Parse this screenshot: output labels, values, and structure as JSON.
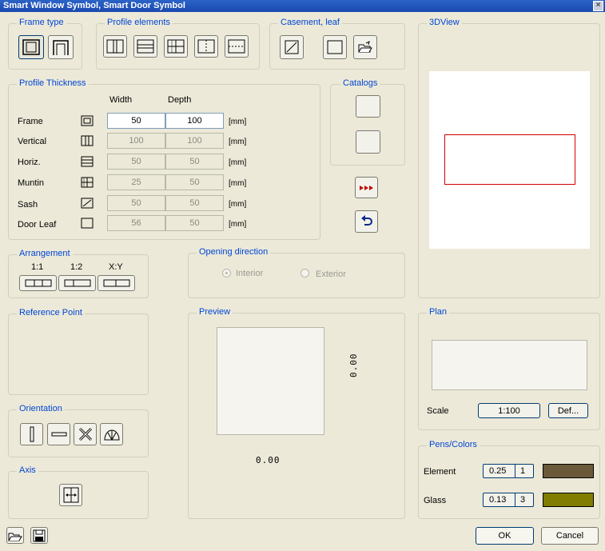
{
  "window": {
    "title": "Smart Window Symbol, Smart Door Symbol",
    "close": "×"
  },
  "groups": {
    "frame_type": "Frame type",
    "profile_elements": "Profile elements",
    "casement": "Casement, leaf",
    "view3d": "3DView",
    "profile_thickness": "Profile Thickness",
    "catalogs": "Catalogs",
    "arrangement": "Arrangement",
    "opening_direction": "Opening direction",
    "reference_point": "Reference Point",
    "preview": "Preview",
    "plan": "Plan",
    "orientation": "Orientation",
    "pens_colors": "Pens/Colors",
    "axis": "Axis"
  },
  "thickness": {
    "width_header": "Width",
    "depth_header": "Depth",
    "unit": "[mm]",
    "rows": [
      {
        "label": "Frame",
        "width": "50",
        "depth": "100"
      },
      {
        "label": "Vertical",
        "width": "100",
        "depth": "100"
      },
      {
        "label": "Horiz.",
        "width": "50",
        "depth": "50"
      },
      {
        "label": "Muntin",
        "width": "25",
        "depth": "50"
      },
      {
        "label": "Sash",
        "width": "50",
        "depth": "50"
      },
      {
        "label": "Door Leaf",
        "width": "56",
        "depth": "50"
      }
    ]
  },
  "arrangement": {
    "opt1": "1:1",
    "opt2": "1:2",
    "opt3": "X:Y"
  },
  "opening": {
    "interior": "Interior",
    "exterior": "Exterior"
  },
  "preview": {
    "x_value": "0.00",
    "y_value": "0.00"
  },
  "plan": {
    "scale_label": "Scale",
    "scale_value": "1:100",
    "def_label": "Def..."
  },
  "pens": {
    "element_label": "Element",
    "element_pen": "0.25",
    "element_num": "1",
    "element_color": "#6b5a3a",
    "glass_label": "Glass",
    "glass_pen": "0.13",
    "glass_num": "3",
    "glass_color": "#807d00"
  },
  "footer": {
    "ok": "OK",
    "cancel": "Cancel"
  }
}
